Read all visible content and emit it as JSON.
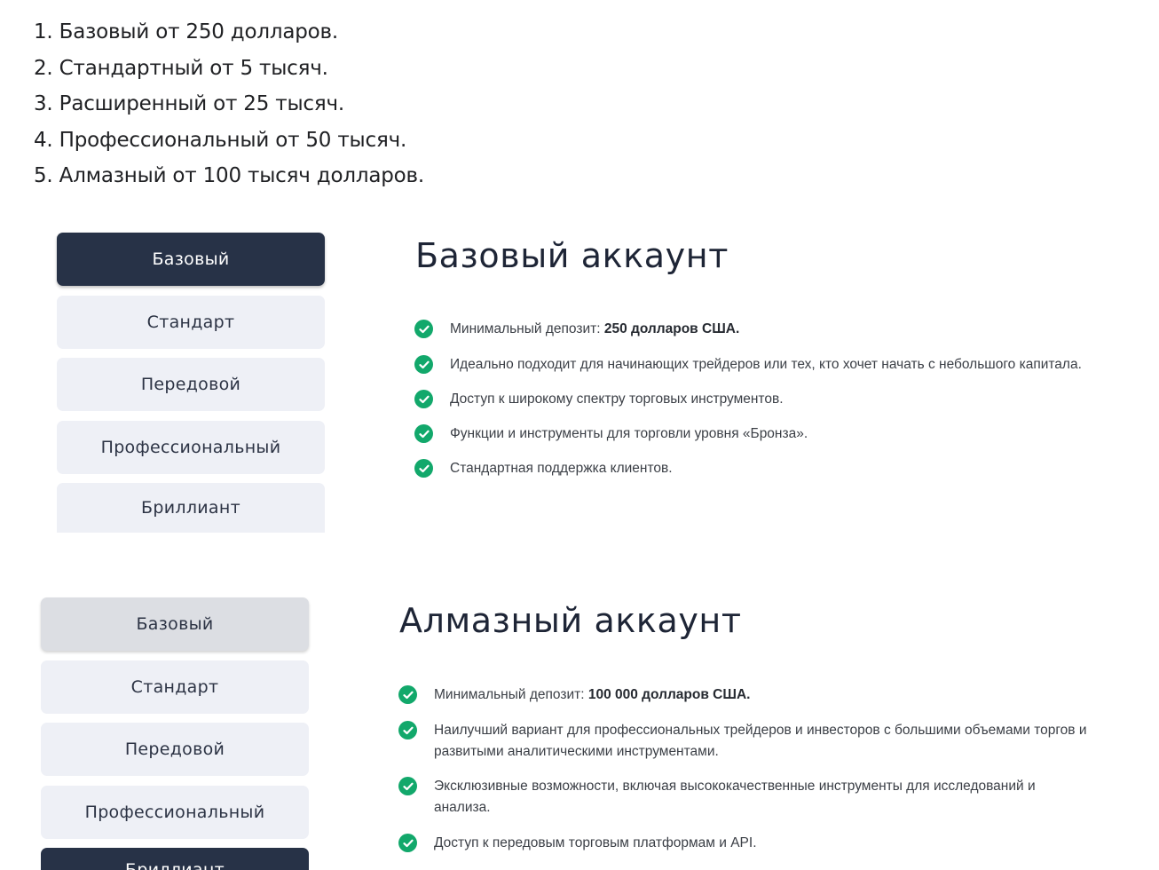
{
  "intro_list": [
    "1. Базовый от 250 долларов.",
    "2. Стандартный от 5 тысяч.",
    "3. Расширенный от 25 тысяч.",
    "4. Профессиональный от 50 тысяч.",
    "5. Алмазный от 100 тысяч долларов."
  ],
  "panel_basic": {
    "tabs": [
      "Базовый",
      "Стандарт",
      "Передовой",
      "Профессиональный",
      "Бриллиант"
    ],
    "active_tab": "Базовый",
    "heading": "Базовый аккаунт",
    "features": [
      {
        "prefix": "Минимальный депозит: ",
        "bold": "250 долларов США.",
        "rest": ""
      },
      {
        "prefix": "Идеально подходит для начинающих трейдеров или тех, кто хочет начать с небольшого капитала.",
        "bold": "",
        "rest": ""
      },
      {
        "prefix": "Доступ к широкому спектру торговых инструментов.",
        "bold": "",
        "rest": ""
      },
      {
        "prefix": "Функции и инструменты для торговли уровня «Бронза».",
        "bold": "",
        "rest": ""
      },
      {
        "prefix": "Стандартная поддержка клиентов.",
        "bold": "",
        "rest": ""
      }
    ]
  },
  "panel_diamond": {
    "tabs": [
      "Базовый",
      "Стандарт",
      "Передовой",
      "Профессиональный",
      "Бриллиант"
    ],
    "active_tab": "Бриллиант",
    "heading": "Алмазный аккаунт",
    "features": [
      {
        "prefix": "Минимальный депозит: ",
        "bold": "100 000 долларов США.",
        "rest": ""
      },
      {
        "prefix": "Наилучший вариант для профессиональных трейдеров и инвесторов с большими объемами торгов и развитыми аналитическими инструментами.",
        "bold": "",
        "rest": ""
      },
      {
        "prefix": "Эксклюзивные возможности, включая высококачественные инструменты для исследований и анализа.",
        "bold": "",
        "rest": ""
      },
      {
        "prefix": "Доступ к передовым торговым платформам и API.",
        "bold": "",
        "rest": ""
      }
    ]
  },
  "colors": {
    "active_tab_bg": "#273247",
    "tab_bg": "#eef0f6",
    "check_green": "#12a86b"
  },
  "icons": {
    "feature_bullet": "check-circle-icon"
  }
}
